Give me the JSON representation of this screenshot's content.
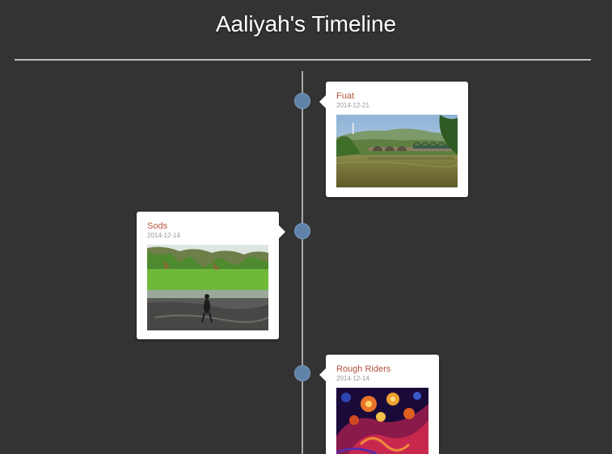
{
  "header": {
    "title": "Aaliyah's Timeline"
  },
  "timeline": {
    "items": [
      {
        "title": "Fuat",
        "date": "2014-12-21",
        "image": "river-bridge-landscape-photo"
      },
      {
        "title": "Sods",
        "date": "2014-12-14",
        "image": "mountain-lake-person-photo"
      },
      {
        "title": "Rough Riders",
        "date": "2014-12-14",
        "image": "fractal-art-image"
      }
    ]
  },
  "colors": {
    "background": "#333333",
    "accent_link": "#b5533c",
    "dot": "#5f82a9",
    "line": "#a8a8a8"
  }
}
